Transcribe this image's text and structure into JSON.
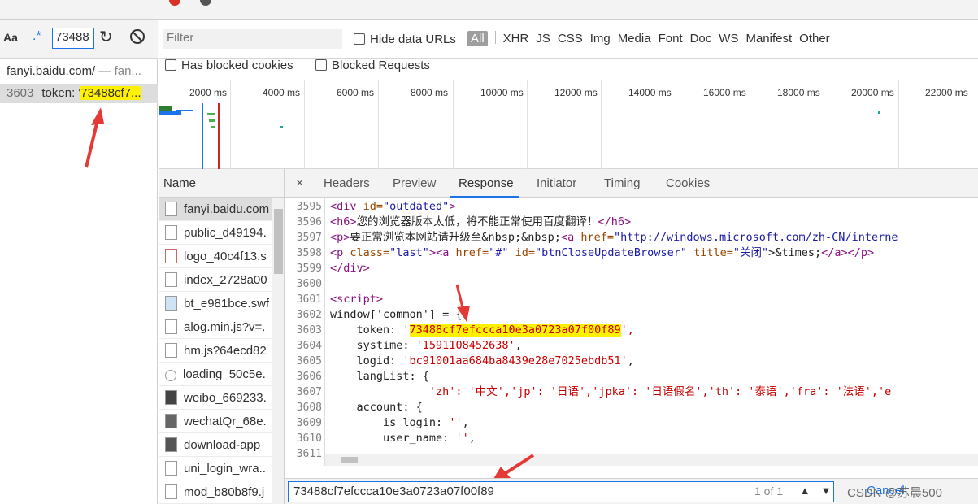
{
  "colors": {
    "accent": "#1a73e8",
    "highlight": "#fff100",
    "arrow": "#e53935"
  },
  "search_panel": {
    "aa_label": "Aa",
    "regex_label": ".*",
    "query": "73488",
    "file_name": "fanyi.baidu.com/",
    "file_suffix": " — fan...",
    "result_line": "3603",
    "result_prefix": "token: '",
    "result_match": "73488cf7..."
  },
  "filter": {
    "placeholder": "Filter",
    "hide_data_urls": "Hide data URLs",
    "all": "All",
    "types": [
      "XHR",
      "JS",
      "CSS",
      "Img",
      "Media",
      "Font",
      "Doc",
      "WS",
      "Manifest",
      "Other"
    ],
    "has_blocked_cookies": "Has blocked cookies",
    "blocked_requests": "Blocked Requests"
  },
  "timeline": {
    "ticks": [
      "2000 ms",
      "4000 ms",
      "6000 ms",
      "8000 ms",
      "10000 ms",
      "12000 ms",
      "14000 ms",
      "16000 ms",
      "18000 ms",
      "20000 ms",
      "22000 ms"
    ]
  },
  "requests": {
    "header": "Name",
    "items": [
      "fanyi.baidu.com",
      "public_d49194.",
      "logo_40c4f13.s",
      "index_2728a00",
      "bt_e981bce.swf",
      "alog.min.js?v=.",
      "hm.js?64ecd82",
      "loading_50c5e.",
      "weibo_669233.",
      "wechatQr_68e.",
      "download-app",
      "uni_login_wra..",
      "mod_b80b8f9.j"
    ]
  },
  "tabs": {
    "close": "×",
    "items": [
      "Headers",
      "Preview",
      "Response",
      "Initiator",
      "Timing",
      "Cookies"
    ],
    "active": "Response"
  },
  "code": {
    "line_numbers": [
      "3595",
      "3596",
      "3597",
      "3598",
      "3599",
      "3600",
      "3601",
      "3602",
      "3603",
      "3604",
      "3605",
      "3606",
      "3607",
      "3608",
      "3609",
      "3610",
      "3611"
    ],
    "l3595_open": "<div ",
    "l3595_attr": "id=",
    "l3595_val": "\"outdated\"",
    "l3595_close": ">",
    "l3596_open": "<h6>",
    "l3596_text": "您的浏览器版本太低，将不能正常使用百度翻译！",
    "l3596_close": "</h6>",
    "l3597_open": "<p>",
    "l3597_text": "要正常浏览本网站请升级至&nbsp;&nbsp;",
    "l3597_a": "<a ",
    "l3597_attr": "href=",
    "l3597_val": "\"http://windows.microsoft.com/zh-CN/interne",
    "l3598_open": "<p ",
    "l3598_attr1": "class=",
    "l3598_val1": "\"last\"",
    "l3598_a": "><a ",
    "l3598_attr2": "href=",
    "l3598_val2": "\"#\"",
    "l3598_attr3": " id=",
    "l3598_val3": "\"btnCloseUpdateBrowser\"",
    "l3598_attr4": " title=",
    "l3598_val4": "\"关闭\"",
    "l3598_text": ">&times;",
    "l3598_close": "</a></p>",
    "l3599": "</div>",
    "l3601": "<script>",
    "l3602": "window['common'] = {",
    "l3603_key": "    token: '",
    "l3603_match": "73488cf7efccca10e3a0723a07f00f89",
    "l3603_end": "',",
    "l3604_key": "    systime: ",
    "l3604_val": "'1591108452638'",
    "l3604_end": ",",
    "l3605_key": "    logid: ",
    "l3605_val": "'bc91001aa684ba8439e28e7025ebdb51'",
    "l3605_end": ",",
    "l3606": "    langList: {",
    "l3607": "               'zh': '中文','jp': '日语','jpka': '日语假名','th': '泰语','fra': '法语','e",
    "l3608": "    account: {",
    "l3609_key": "        is_login: ",
    "l3609_val": "''",
    "l3609_end": ",",
    "l3610_key": "        user_name: ",
    "l3610_val": "''",
    "l3610_end": ","
  },
  "bottom_search": {
    "query": "73488cf7efccca10e3a0723a07f00f89",
    "match_count": "1 of 1",
    "prev": "▲",
    "next": "▼",
    "cancel": "Cancel",
    "watermark": "CSDN @苏晨500"
  }
}
